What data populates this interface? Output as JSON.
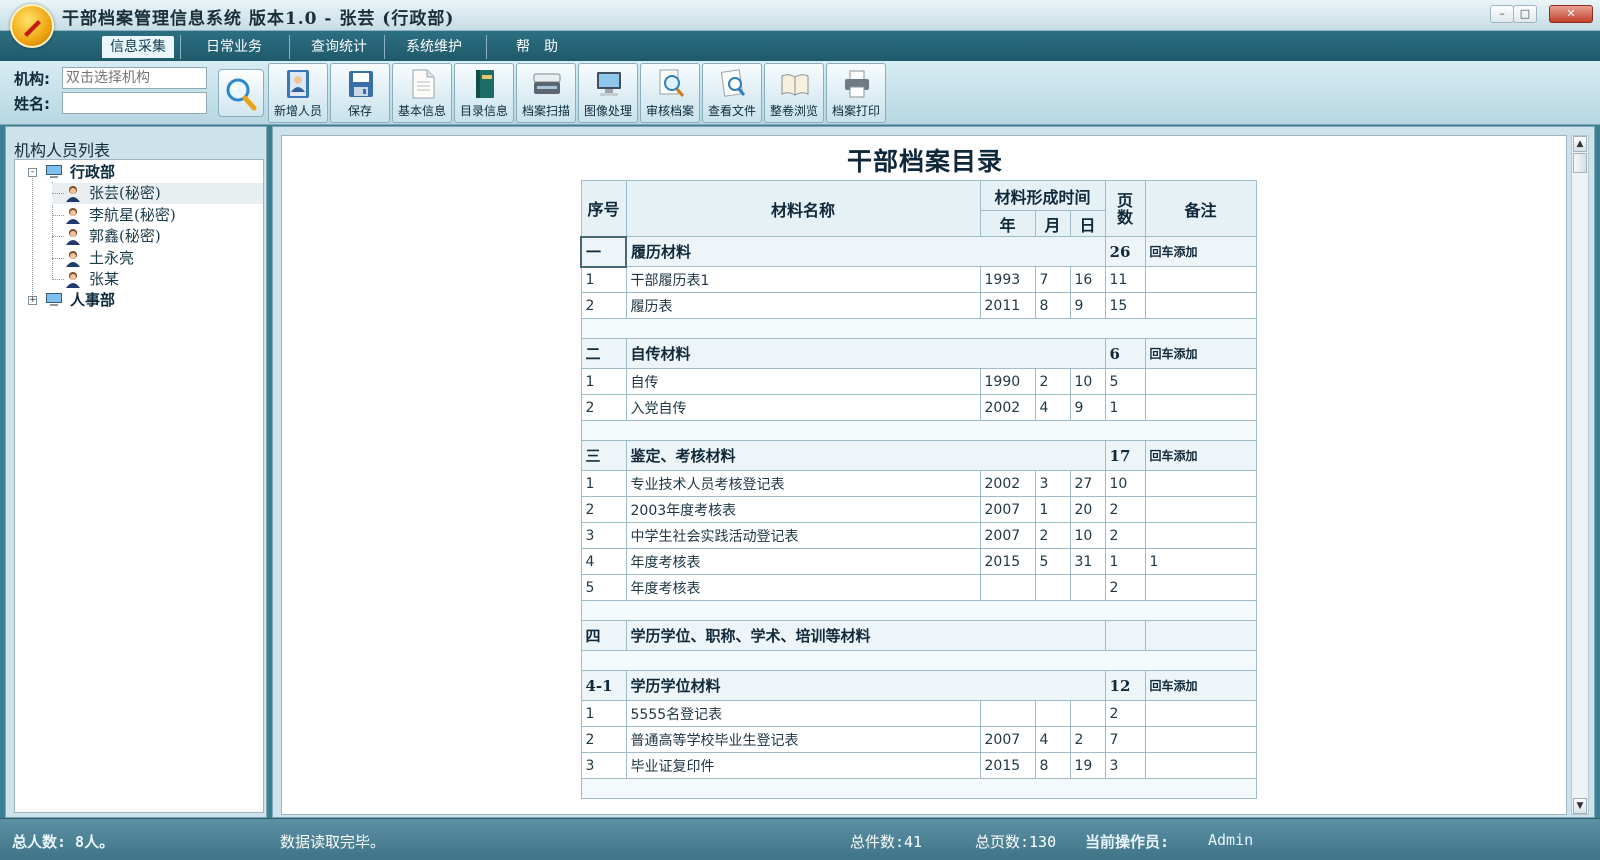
{
  "window": {
    "title": "干部档案管理信息系统 版本1.0 - 张芸 (行政部)",
    "icons": [
      "party-emblem-icon",
      "minimize-icon",
      "maximize-icon",
      "close-icon"
    ]
  },
  "menu": {
    "items": [
      {
        "label": "信息采集",
        "active": true
      },
      {
        "label": "日常业务",
        "active": false
      },
      {
        "label": "查询统计",
        "active": false
      },
      {
        "label": "系统维护",
        "active": false
      },
      {
        "label": "帮　助",
        "active": false
      }
    ]
  },
  "filters": {
    "org_label": "机构:",
    "org_placeholder": "双击选择机构",
    "name_label": "姓名:",
    "name_value": ""
  },
  "toolbar": {
    "buttons": [
      {
        "label": "新增人员",
        "icon": "add-person-icon"
      },
      {
        "label": "保存",
        "icon": "save-disk-icon"
      },
      {
        "label": "基本信息",
        "icon": "document-icon"
      },
      {
        "label": "目录信息",
        "icon": "book-icon"
      },
      {
        "label": "档案扫描",
        "icon": "scanner-icon"
      },
      {
        "label": "图像处理",
        "icon": "computer-icon"
      },
      {
        "label": "审核档案",
        "icon": "magnifier-icon"
      },
      {
        "label": "查看文件",
        "icon": "view-file-icon"
      },
      {
        "label": "整卷浏览",
        "icon": "open-book-icon"
      },
      {
        "label": "档案打印",
        "icon": "printer-icon"
      }
    ]
  },
  "sidebar": {
    "title": "机构人员列表",
    "departments": [
      {
        "name": "行政部",
        "expanded": true,
        "expander": "-",
        "people": [
          "张芸(秘密)",
          "李航星(秘密)",
          "郭鑫(秘密)",
          "土永亮",
          "张某"
        ]
      },
      {
        "name": "人事部",
        "expanded": false,
        "expander": "+",
        "people": []
      }
    ],
    "selected_person": "张芸(秘密)"
  },
  "catalog": {
    "title": "干部档案目录",
    "headers": {
      "seq": "序号",
      "name": "材料名称",
      "time": "材料形成时间",
      "year": "年",
      "month": "月",
      "day": "日",
      "pages": "页\n数",
      "notes": "备注"
    },
    "rows": [
      {
        "kind": "section",
        "seq": "一",
        "name": "履历材料",
        "pages": "26",
        "notes": "回车添加"
      },
      {
        "kind": "item",
        "seq": "1",
        "name": "干部履历表1",
        "year": "1993",
        "month": "7",
        "day": "16",
        "pages": "11",
        "notes": ""
      },
      {
        "kind": "item",
        "seq": "2",
        "name": "履历表",
        "year": "2011",
        "month": "8",
        "day": "9",
        "pages": "15",
        "notes": ""
      },
      {
        "kind": "blank"
      },
      {
        "kind": "section",
        "seq": "二",
        "name": "自传材料",
        "pages": "6",
        "notes": "回车添加"
      },
      {
        "kind": "item",
        "seq": "1",
        "name": "自传",
        "year": "1990",
        "month": "2",
        "day": "10",
        "pages": "5",
        "notes": ""
      },
      {
        "kind": "item",
        "seq": "2",
        "name": "入党自传",
        "year": "2002",
        "month": "4",
        "day": "9",
        "pages": "1",
        "notes": ""
      },
      {
        "kind": "blank"
      },
      {
        "kind": "section",
        "seq": "三",
        "name": "鉴定、考核材料",
        "pages": "17",
        "notes": "回车添加"
      },
      {
        "kind": "item",
        "seq": "1",
        "name": "专业技术人员考核登记表",
        "year": "2002",
        "month": "3",
        "day": "27",
        "pages": "10",
        "notes": ""
      },
      {
        "kind": "item",
        "seq": "2",
        "name": "2003年度考核表",
        "year": "2007",
        "month": "1",
        "day": "20",
        "pages": "2",
        "notes": ""
      },
      {
        "kind": "item",
        "seq": "3",
        "name": "中学生社会实践活动登记表",
        "year": "2007",
        "month": "2",
        "day": "10",
        "pages": "2",
        "notes": ""
      },
      {
        "kind": "item",
        "seq": "4",
        "name": "年度考核表",
        "year": "2015",
        "month": "5",
        "day": "31",
        "pages": "1",
        "notes": "1"
      },
      {
        "kind": "item",
        "seq": "5",
        "name": "年度考核表",
        "year": "",
        "month": "",
        "day": "",
        "pages": "2",
        "notes": ""
      },
      {
        "kind": "blank"
      },
      {
        "kind": "section",
        "seq": "四",
        "name": "学历学位、职称、学术、培训等材料",
        "pages": "",
        "notes": ""
      },
      {
        "kind": "blank"
      },
      {
        "kind": "section",
        "seq": "4-1",
        "name": "学历学位材料",
        "pages": "12",
        "notes": "回车添加"
      },
      {
        "kind": "item",
        "seq": "1",
        "name": "5555名登记表",
        "year": "",
        "month": "",
        "day": "",
        "pages": "2",
        "notes": ""
      },
      {
        "kind": "item",
        "seq": "2",
        "name": "普通高等学校毕业生登记表",
        "year": "2007",
        "month": "4",
        "day": "2",
        "pages": "7",
        "notes": ""
      },
      {
        "kind": "item",
        "seq": "3",
        "name": "毕业证复印件",
        "year": "2015",
        "month": "8",
        "day": "19",
        "pages": "3",
        "notes": ""
      },
      {
        "kind": "blank"
      }
    ]
  },
  "status": {
    "total_people": "总人数: 8人。",
    "message": "数据读取完毕。",
    "total_items": "总件数:41",
    "total_pages": "总页数:130",
    "operator_label": "当前操作员:",
    "operator": "Admin"
  }
}
